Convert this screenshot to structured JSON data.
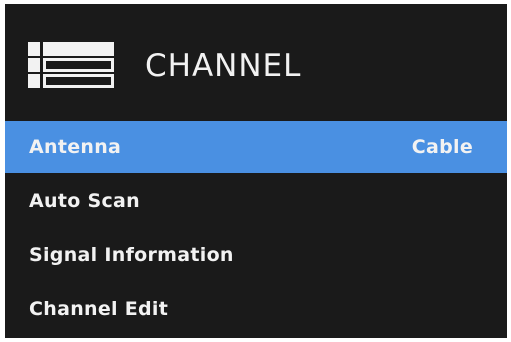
{
  "menu": {
    "title": "CHANNEL",
    "icon": "list-menu-icon",
    "items": [
      {
        "label": "Antenna",
        "value": "Cable",
        "selected": true
      },
      {
        "label": "Auto Scan"
      },
      {
        "label": "Signal Information"
      },
      {
        "label": "Channel Edit"
      }
    ]
  },
  "colors": {
    "panel_background": "#1a1a1a",
    "selection_highlight": "#4a90e2",
    "text": "#f2f2f2"
  }
}
